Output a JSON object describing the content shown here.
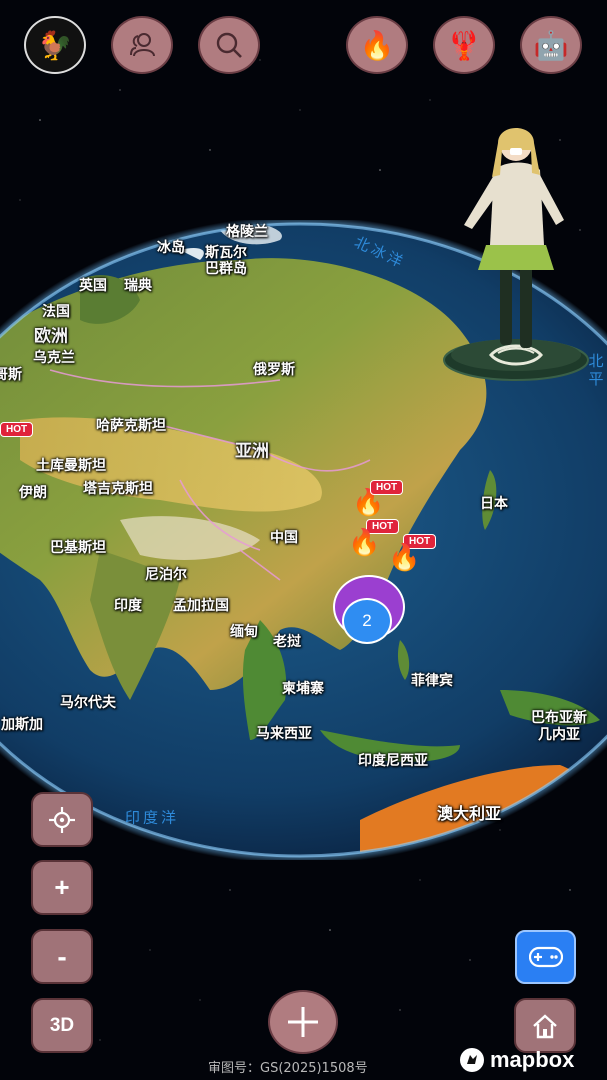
{
  "top_bar": {
    "avatar_icon": "rooster-icon",
    "friends_icon": "people-icon",
    "search_icon": "search-icon",
    "hot_icon": "fire-icon",
    "lobster_icon": "lobster-icon",
    "robot_icon": "robot-icon"
  },
  "map_labels": {
    "greenland": "格陵兰",
    "iceland": "冰岛",
    "svalbard": "斯瓦尔\n巴群岛",
    "arctic_ocean": "北冰洋",
    "uk": "英国",
    "sweden": "瑞典",
    "france": "法国",
    "europe": "欧洲",
    "ukraine": "乌克兰",
    "left_edge_1": "哥斯",
    "russia": "俄罗斯",
    "kazakhstan": "哈萨克斯坦",
    "asia": "亚洲",
    "turkmenistan": "土库曼斯坦",
    "iran": "伊朗",
    "tajikistan": "塔吉克斯坦",
    "china": "中国",
    "japan": "日本",
    "pakistan": "巴基斯坦",
    "nepal": "尼泊尔",
    "india": "印度",
    "bangladesh": "孟加拉国",
    "myanmar": "缅甸",
    "laos": "老挝",
    "maldives": "马尔代夫",
    "cambodia": "柬埔寨",
    "philippines": "菲律宾",
    "madagascar": "加斯加",
    "malaysia": "马来西亚",
    "png": "巴布亚新\n几内亚",
    "indonesia": "印度尼西亚",
    "indian_ocean": "印度洋",
    "australia": "澳大利亚",
    "pacific_edge": "北\n平"
  },
  "markers": {
    "hot_label": "HOT",
    "cluster_count": "2"
  },
  "controls": {
    "locate_icon": "crosshair-icon",
    "zoom_in": "+",
    "zoom_out": "-",
    "view_3d": "3D",
    "add_icon": "plus-icon",
    "game_icon": "gamepad-icon",
    "home_icon": "home-icon"
  },
  "footer": {
    "approval_number": "审图号：GS(2025)1508号",
    "attribution": "mapbox"
  },
  "colors": {
    "button_fill": "#b07c80",
    "cluster_purple": "#9b3fd0",
    "cluster_blue": "#2f8df2",
    "hot_red": "#e0243b",
    "game_blue": "#2a7ff3"
  }
}
